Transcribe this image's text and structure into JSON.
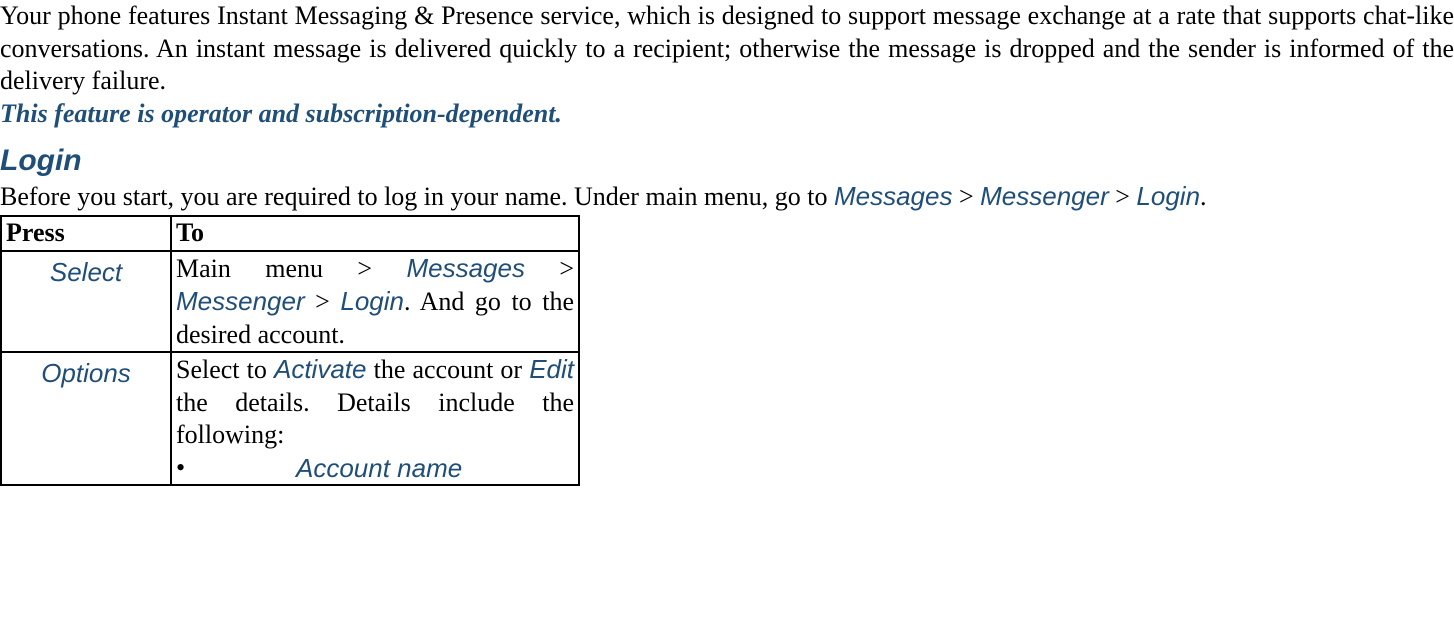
{
  "intro": {
    "body": "Your phone features Instant Messaging & Presence service, which is designed to support message exchange at a rate that supports chat-like conversations. An instant message is delivered quickly to a recipient; otherwise the message is dropped and the sender is informed of the delivery failure."
  },
  "note": "This feature is operator and subscription-dependent.",
  "section": {
    "heading": "Login",
    "pre_text": "Before you start, you are required to log in your name. Under main menu, go to ",
    "path1": "Messages",
    "sep": " > ",
    "path2": "Messenger",
    "path3": "Login",
    "period": "."
  },
  "table": {
    "head_press": "Press",
    "head_to": "To",
    "row1": {
      "press": "Select",
      "to_prefix": "Main menu > ",
      "to_kw1": "Messages",
      "to_sep1": " > ",
      "to_kw2": "Messenger",
      "to_sep2": " > ",
      "to_kw3": "Login",
      "to_suffix": ". And go to the desired account."
    },
    "row2": {
      "press": "Options",
      "to_prefix": "Select to ",
      "to_kw1": "Activate",
      "to_mid1": " the account or ",
      "to_kw2": "Edit",
      "to_mid2": " the details. Details include the following:",
      "bullet_mark": "•",
      "bullet_text": "Account name"
    }
  }
}
